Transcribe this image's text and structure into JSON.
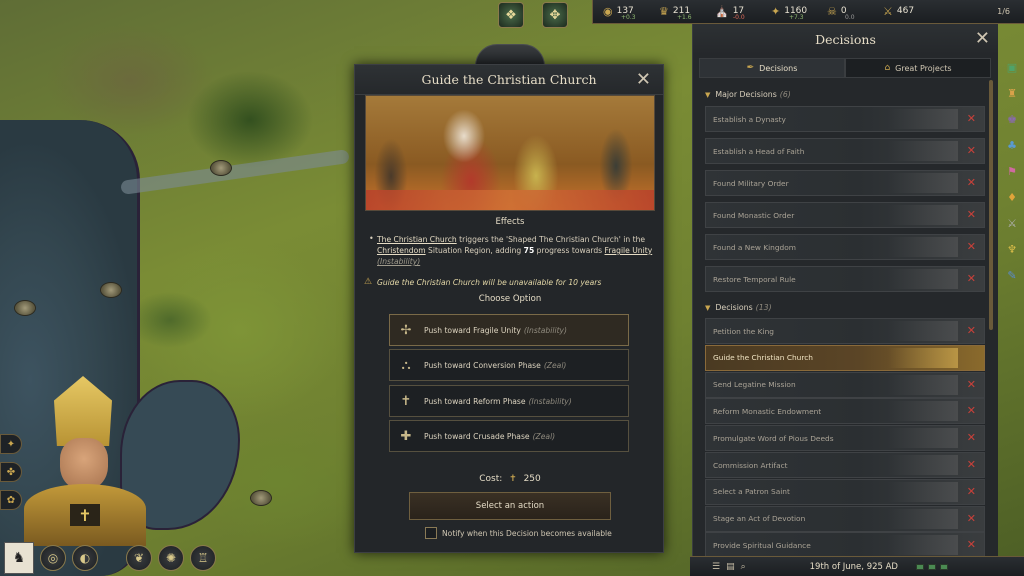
{
  "top_bar": {
    "resources": [
      {
        "name": "gold",
        "icon": "coins-icon",
        "value": "137",
        "delta": "+0.3",
        "delta_type": "pos"
      },
      {
        "name": "prestige",
        "icon": "prestige-icon",
        "value": "211",
        "delta": "+1.6",
        "delta_type": "pos"
      },
      {
        "name": "piety",
        "icon": "piety-icon",
        "value": "17",
        "delta": "-0.0",
        "delta_type": "neg"
      },
      {
        "name": "renown",
        "icon": "renown-icon",
        "value": "1160",
        "delta": "+7.3",
        "delta_type": "pos"
      },
      {
        "name": "dread",
        "icon": "dread-icon",
        "value": "0",
        "delta": "0.0",
        "delta_type": "zero"
      },
      {
        "name": "soldiers",
        "icon": "soldiers-icon",
        "value": "467",
        "delta": "",
        "delta_type": "zero"
      }
    ],
    "domain_limit": "1/6"
  },
  "modal": {
    "title": "Guide the Christian Church",
    "effects_label": "Effects",
    "effects": {
      "link_church": "The Christian Church",
      "text_1": " triggers the 'Shaped The Christian Church' in the ",
      "link_region": "Christendom",
      "text_2": " Situation Region, adding ",
      "amount": "75",
      "text_3": " progress towards ",
      "link_phase": "Fragile Unity",
      "phase_tag": "(Instability)"
    },
    "warning": "Guide the Christian Church will be unavailable for 10 years",
    "choose_label": "Choose Option",
    "options": [
      {
        "label": "Push toward Fragile Unity",
        "tag": "(Instability)",
        "icon": "cross-hand-icon",
        "glyph": "✢"
      },
      {
        "label": "Push toward Conversion Phase",
        "tag": "(Zeal)",
        "icon": "crowd-icon",
        "glyph": "⛬"
      },
      {
        "label": "Push toward Reform Phase",
        "tag": "(Instability)",
        "icon": "crucifix-icon",
        "glyph": "✝"
      },
      {
        "label": "Push toward Crusade Phase",
        "tag": "(Zeal)",
        "icon": "crusader-shield-icon",
        "glyph": "✚"
      }
    ],
    "cost_label": "Cost:",
    "cost_value": "250",
    "select_button": "Select an action",
    "notify_label": "Notify when this Decision becomes available"
  },
  "decisions_panel": {
    "title": "Decisions",
    "tabs": [
      {
        "label": "Decisions",
        "icon": "quill-icon"
      },
      {
        "label": "Great Projects",
        "icon": "building-icon"
      }
    ],
    "major_header": "Major Decisions",
    "major_count": "(6)",
    "major_items": [
      "Establish a Dynasty",
      "Establish a Head of Faith",
      "Found Military Order",
      "Found Monastic Order",
      "Found a New Kingdom",
      "Restore Temporal Rule"
    ],
    "decisions_header": "Decisions",
    "decisions_count": "(13)",
    "decision_items": [
      "Petition the King",
      "Guide the Christian Church",
      "Send Legatine Mission",
      "Reform Monastic Endowment",
      "Promulgate Word of Pious Deeds",
      "Commission Artifact",
      "Select a Patron Saint",
      "Stage an Act of Devotion",
      "Provide Spiritual Guidance"
    ]
  },
  "bottom_bar": {
    "date": "19th of June, 925 AD"
  },
  "colors": {
    "accent_gold": "#c9a650",
    "unavailable_x": "#c9413a",
    "panel_bg": "#25282b"
  }
}
